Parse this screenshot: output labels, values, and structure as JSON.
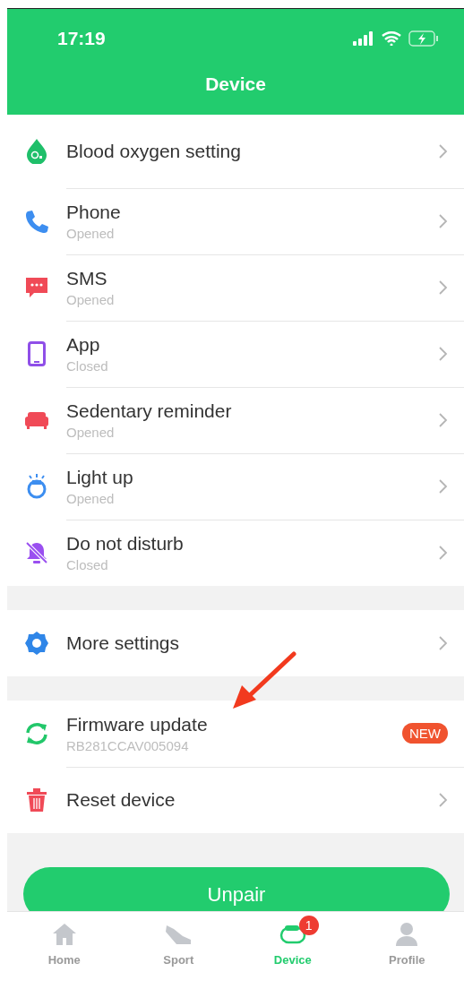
{
  "status_bar": {
    "time": "17:19"
  },
  "header": {
    "title": "Device"
  },
  "sections": [
    {
      "items": [
        {
          "label": "Blood oxygen setting"
        },
        {
          "label": "Phone",
          "status": "Opened"
        },
        {
          "label": "SMS",
          "status": "Opened"
        },
        {
          "label": "App",
          "status": "Closed"
        },
        {
          "label": "Sedentary reminder",
          "status": "Opened"
        },
        {
          "label": "Light up",
          "status": "Opened"
        },
        {
          "label": "Do not disturb",
          "status": "Closed"
        }
      ]
    },
    {
      "items": [
        {
          "label": "More settings"
        }
      ]
    },
    {
      "items": [
        {
          "label": "Firmware update",
          "status": "RB281CCAV005094",
          "badge": "NEW"
        },
        {
          "label": "Reset device"
        }
      ]
    }
  ],
  "unpair_button": "Unpair",
  "tabs": [
    {
      "label": "Home",
      "selected": false
    },
    {
      "label": "Sport",
      "selected": false
    },
    {
      "label": "Device",
      "selected": true,
      "badge": "1"
    },
    {
      "label": "Profile",
      "selected": false
    }
  ]
}
